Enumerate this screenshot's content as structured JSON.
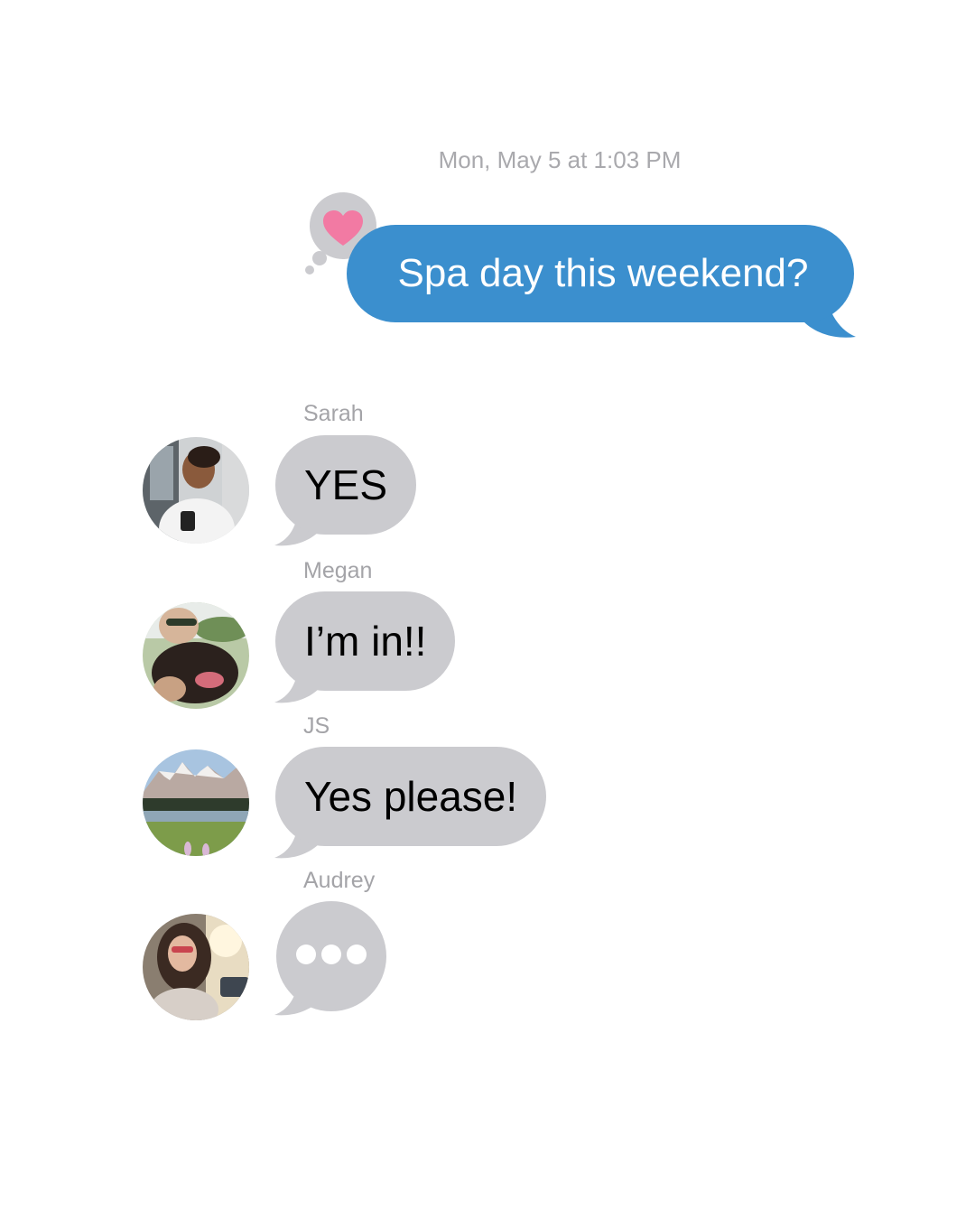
{
  "conversation": {
    "timestamp": "Mon, May 5 at 1:03 PM",
    "outgoing": {
      "text": "Spa day this weekend?",
      "reaction_icon": "heart-icon",
      "bubble_color": "#3b8fce"
    },
    "incoming": [
      {
        "sender": "Sarah",
        "text": "YES"
      },
      {
        "sender": "Megan",
        "text": "I’m in!!"
      },
      {
        "sender": "JS",
        "text": "Yes please!"
      },
      {
        "sender": "Audrey",
        "typing": true
      }
    ],
    "incoming_bubble_color": "#cbcbcf",
    "reaction_color": "#f27aa3"
  }
}
